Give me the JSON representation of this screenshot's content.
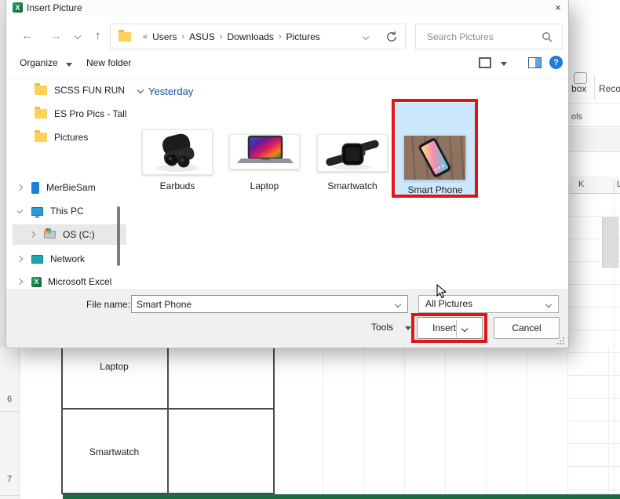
{
  "window": {
    "title": "Insert Picture"
  },
  "icons": {
    "close": "×",
    "back": "←",
    "forward": "→",
    "up": "↑",
    "breadcrumb_prefix": "«",
    "crumb_sep": "›",
    "help": "?"
  },
  "nav": {
    "crumbs": [
      "Users",
      "ASUS",
      "Downloads",
      "Pictures"
    ],
    "search_placeholder": "Search Pictures"
  },
  "toolbar": {
    "organize": "Organize",
    "new_folder": "New folder"
  },
  "sidebar": {
    "folders": [
      "SCSS FUN RUN",
      "ES Pro Pics - Tall",
      "Pictures"
    ],
    "tree": [
      {
        "label": "MerBieSam"
      },
      {
        "label": "This PC"
      },
      {
        "label": "OS (C:)",
        "selected": true
      },
      {
        "label": "Network"
      },
      {
        "label": "Microsoft Excel"
      }
    ]
  },
  "files": {
    "group_label": "Yesterday",
    "items": [
      {
        "name": "Earbuds"
      },
      {
        "name": "Laptop"
      },
      {
        "name": "Smartwatch"
      },
      {
        "name": "Smart Phone",
        "selected": true
      }
    ]
  },
  "footer": {
    "file_name_label": "File name:",
    "file_name_value": "Smart Phone",
    "file_type_value": "All Pictures",
    "tools_label": "Tools",
    "insert_label": "Insert",
    "cancel_label": "Cancel"
  },
  "excel": {
    "ribbon_fragments": {
      "a": "box",
      "b": "Reco",
      "c": "ols"
    },
    "column_header_k": "K",
    "column_header_l": "L",
    "row_6": "6",
    "row_7": "7",
    "cell_laptop": "Laptop",
    "cell_smartwatch": "Smartwatch"
  },
  "colors": {
    "annotation": "#dd1616",
    "selection": "#cce8ff",
    "excel_green": "#1b6a41"
  }
}
